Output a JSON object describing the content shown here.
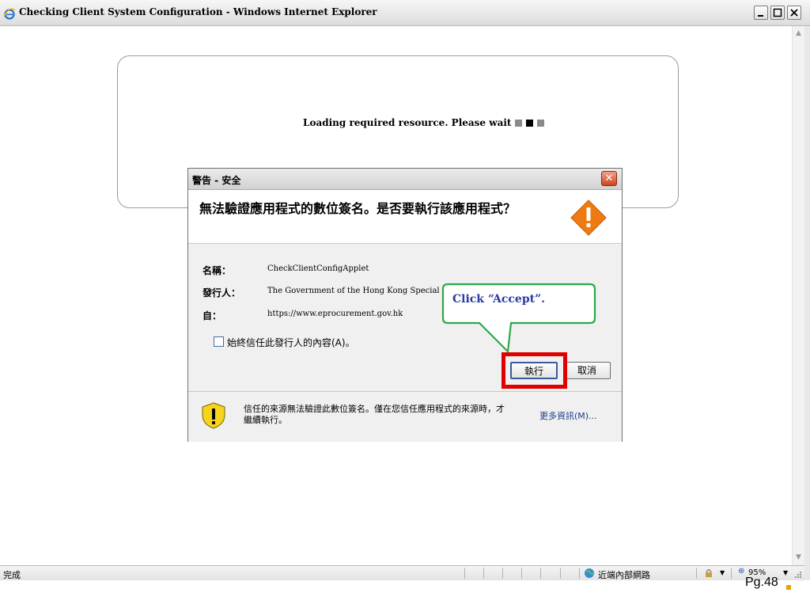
{
  "window": {
    "title": "Checking Client System Configuration - Windows Internet Explorer"
  },
  "page": {
    "loading_text": "Loading required resource. Please wait"
  },
  "dialog": {
    "title": "警告 - 安全",
    "question": "無法驗證應用程式的數位簽名。是否要執行該應用程式？",
    "fields": [
      {
        "label": "名稱：",
        "value": "CheckClientConfigApplet"
      },
      {
        "label": "發行人：",
        "value": "The Government of the Hong Kong Special"
      },
      {
        "label": "自：",
        "value": "https://www.eprocurement.gov.hk"
      }
    ],
    "checkbox_label": "始終信任此發行人的內容(A)。",
    "checkbox_checked": false,
    "run_button": "執行",
    "cancel_button": "取消",
    "footer_text": "信任的來源無法驗證此數位簽名。僅在您信任應用程式的來源時，才繼續執行。",
    "more_info": "更多資訊(M)..."
  },
  "annotation": {
    "callout_text": "Click “Accept”.",
    "highlight_color": "#e00000",
    "callout_border_color": "#2ea84a"
  },
  "statusbar": {
    "status": "完成",
    "zone": "近端內部網路",
    "zoom": "95%"
  },
  "footer": {
    "page_label": "Pg.48"
  }
}
